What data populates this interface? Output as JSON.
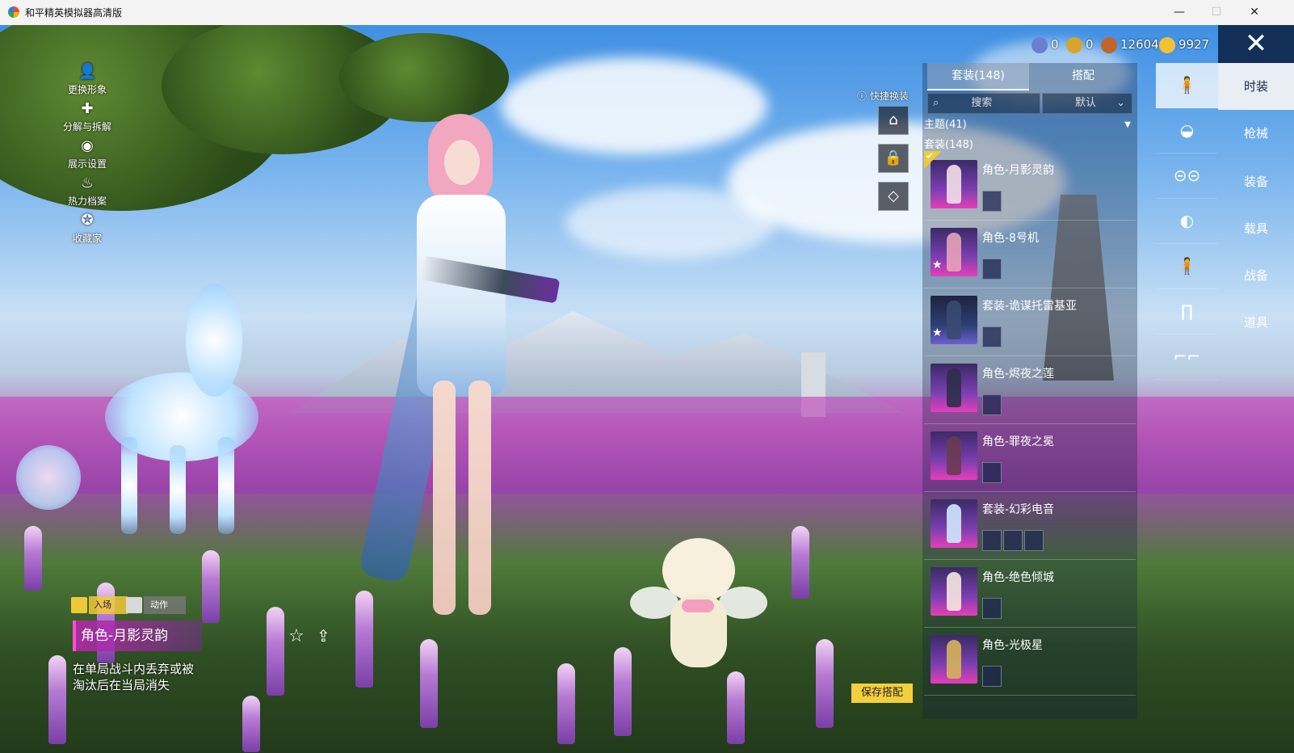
{
  "window": {
    "title": "和平精英模拟器高清版",
    "minimize": "—",
    "maximize": "☐",
    "close": "✕"
  },
  "left_menu": [
    {
      "label": "更换形象",
      "icon": "person-icon"
    },
    {
      "label": "分解与拆解",
      "icon": "puzzle-icon"
    },
    {
      "label": "展示设置",
      "icon": "eye-icon"
    },
    {
      "label": "热力档案",
      "icon": "flame-icon"
    },
    {
      "label": "收藏家",
      "icon": "collector-badge-icon"
    }
  ],
  "currency": [
    {
      "icon": "globe-coin-icon",
      "value": "0",
      "color": "#6a7fd0"
    },
    {
      "icon": "gold-coin-icon",
      "value": "0",
      "color": "#d7a52e"
    },
    {
      "icon": "copper-coin-icon",
      "value": "12604",
      "color": "#c2652a"
    },
    {
      "icon": "yellow-coin-icon",
      "value": "9927",
      "color": "#f1c232"
    }
  ],
  "panel": {
    "tabs": [
      {
        "label": "套装(148)",
        "active": true
      },
      {
        "label": "搭配",
        "active": false
      }
    ],
    "search_label": "搜索",
    "sort_label": "默认",
    "theme_label": "主题(41)",
    "sets_label": "套装(148)",
    "quick_change_label": "快捷换装",
    "outfits": [
      {
        "label": "角色-月影灵韵",
        "selected": true,
        "star": false,
        "subs": 1
      },
      {
        "label": "角色-8号机",
        "selected": false,
        "star": true,
        "subs": 1
      },
      {
        "label": "套装-诡谋托雷基亚",
        "selected": false,
        "star": true,
        "subs": 1
      },
      {
        "label": "角色-烬夜之莲",
        "selected": false,
        "star": false,
        "subs": 1
      },
      {
        "label": "角色-罪夜之冕",
        "selected": false,
        "star": false,
        "subs": 1
      },
      {
        "label": "套装-幻彩电音",
        "selected": false,
        "star": false,
        "subs": 3
      },
      {
        "label": "角色-绝色倾城",
        "selected": false,
        "star": false,
        "subs": 1
      },
      {
        "label": "角色-光极星",
        "selected": false,
        "star": false,
        "subs": 1
      }
    ]
  },
  "categories": [
    {
      "label": "时装",
      "active": true
    },
    {
      "label": "枪械",
      "active": false
    },
    {
      "label": "装备",
      "active": false
    },
    {
      "label": "载具",
      "active": false
    },
    {
      "label": "战备",
      "active": false
    },
    {
      "label": "道具",
      "active": false
    }
  ],
  "strip_icons": [
    "full-body-icon",
    "cap-icon",
    "glasses-icon",
    "face-mask-icon",
    "top-wear-icon",
    "pants-icon",
    "shoes-icon"
  ],
  "motion": {
    "entry_label": "入场",
    "action_label": "动作"
  },
  "item": {
    "name": "角色-月影灵韵",
    "desc_line1": "在单局战斗内丢弃或被",
    "desc_line2": "淘汰后在当局消失"
  },
  "save_label": "保存搭配"
}
